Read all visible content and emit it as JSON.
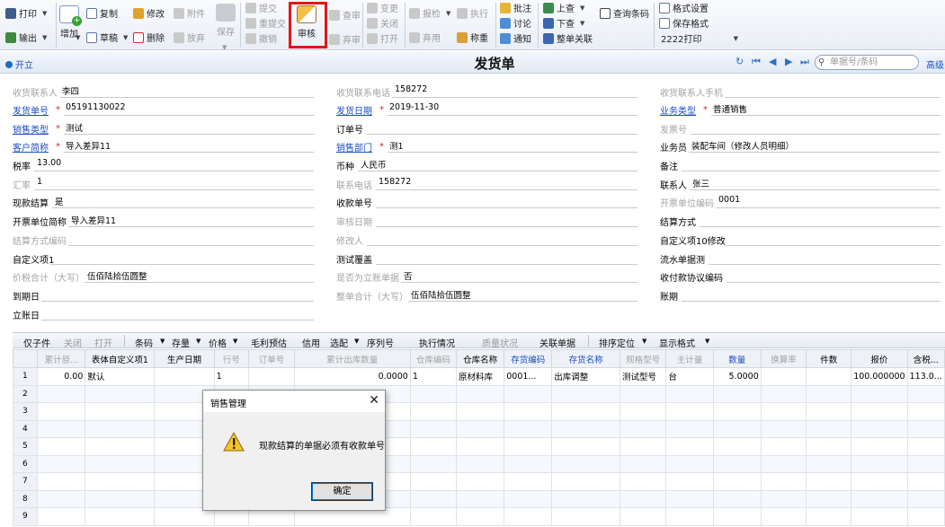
{
  "toolbar": {
    "print": "打印",
    "export": "输出",
    "add": "增加",
    "copy": "复制",
    "draft": "草稿",
    "modify": "修改",
    "delete": "删除",
    "attach": "附件",
    "abandon": "放弃",
    "save": "保存",
    "submit": "提交",
    "resubmit": "重提交",
    "withdraw": "撤销",
    "review": "审核",
    "check": "查审",
    "discard": "弃审",
    "change": "变更",
    "close": "关闭",
    "open": "打开",
    "reportcheck": "报检",
    "reverse": "弃用",
    "execute": "执行",
    "weigh": "称重",
    "annotate": "批注",
    "discuss": "讨论",
    "notify": "通知",
    "prev_query": "上查",
    "next_query": "下查",
    "link": "整单关联",
    "query_barcode": "查询条码",
    "format_settings": "格式设置",
    "save_format": "保存格式",
    "print_template": "2222打印"
  },
  "header": {
    "open": "开立",
    "title": "发货单",
    "search_placeholder": "单据号/条码",
    "advanced": "高级"
  },
  "form": {
    "f_contact": "收货联系人",
    "v_contact": "李四",
    "f_phone": "收货联系电话",
    "v_phone": "158272",
    "f_mobile": "收货联系人手机",
    "f_no": "发货单号",
    "v_no": "05191130022",
    "f_date": "发货日期",
    "v_date": "2019-11-30",
    "f_btype": "业务类型",
    "v_btype": "普通销售",
    "f_stype": "销售类型",
    "v_stype": "测试",
    "f_order": "订单号",
    "f_invno": "发票号",
    "f_customer": "客户简称",
    "v_customer": "导入差异11",
    "f_dept": "销售部门",
    "v_dept": "测1",
    "f_salesman": "业务员",
    "v_salesman": "装配车间（修改人员明细）",
    "f_tax": "税率",
    "v_tax": "13.00",
    "f_currency": "币种",
    "v_currency": "人民币",
    "f_remark": "备注",
    "f_rate": "汇率",
    "v_rate": "1",
    "f_tel": "联系电话",
    "v_tel": "158272",
    "f_person": "联系人",
    "v_person": "张三",
    "f_cash": "现款结算",
    "v_cash": "是",
    "f_receipt": "收款单号",
    "f_invunitcode": "开票单位编码",
    "v_invunitcode": "0001",
    "f_invunit": "开票单位简称",
    "v_invunit": "导入差异11",
    "f_auditdate": "审核日期",
    "f_settle": "结算方式",
    "f_settlecode": "结算方式编码",
    "f_modifier": "修改人",
    "f_def10": "自定义项10修改",
    "f_def1": "自定义项1",
    "f_cover": "测试覆盖",
    "f_flow": "流水单据测",
    "f_total": "价税合计（大写）",
    "v_total": "伍佰陆拾伍圆整",
    "f_isbill": "是否为立账单据",
    "v_isbill": "否",
    "f_protocol": "收付款协议编码",
    "f_due": "到期日",
    "f_wholetotal": "整单合计（大写）",
    "v_wholetotal": "伍佰陆拾伍圆整",
    "f_period": "账期",
    "f_acctdate": "立账日"
  },
  "grid_toolbar": [
    "仅子件",
    "关闭",
    "打开",
    "条码",
    "存量",
    "价格",
    "毛利预估",
    "信用",
    "选配",
    "序列号",
    "执行情况",
    "质量状况",
    "关联单据",
    "排序定位",
    "显示格式"
  ],
  "grid": {
    "columns": [
      "",
      "累计原...",
      "表体自定义项1",
      "生产日期",
      "行号",
      "订单号",
      "累计出库数量",
      "仓库编码",
      "仓库名称",
      "存货编码",
      "存货名称",
      "规格型号",
      "主计量",
      "数量",
      "换算率",
      "件数",
      "报价",
      "含税..."
    ],
    "rows": [
      [
        "1",
        "0.00",
        "默认",
        "",
        "1",
        "",
        "0.0000",
        "1",
        "原材料库",
        "0001...",
        "出库调整",
        "测试型号",
        "台",
        "5.0000",
        "",
        "",
        "100.000000",
        "113.0..."
      ],
      [
        "2",
        "",
        "",
        "",
        "",
        "",
        "",
        "",
        "",
        "",
        "",
        "",
        "",
        "",
        "",
        "",
        "",
        ""
      ],
      [
        "3",
        "",
        "",
        "",
        "",
        "",
        "",
        "",
        "",
        "",
        "",
        "",
        "",
        "",
        "",
        "",
        "",
        ""
      ],
      [
        "4",
        "",
        "",
        "",
        "",
        "",
        "",
        "",
        "",
        "",
        "",
        "",
        "",
        "",
        "",
        "",
        "",
        ""
      ],
      [
        "5",
        "",
        "",
        "",
        "",
        "",
        "",
        "",
        "",
        "",
        "",
        "",
        "",
        "",
        "",
        "",
        "",
        ""
      ],
      [
        "6",
        "",
        "",
        "",
        "",
        "",
        "",
        "",
        "",
        "",
        "",
        "",
        "",
        "",
        "",
        "",
        "",
        ""
      ],
      [
        "7",
        "",
        "",
        "",
        "",
        "",
        "",
        "",
        "",
        "",
        "",
        "",
        "",
        "",
        "",
        "",
        "",
        ""
      ],
      [
        "8",
        "",
        "",
        "",
        "",
        "",
        "",
        "",
        "",
        "",
        "",
        "",
        "",
        "",
        "",
        "",
        "",
        ""
      ],
      [
        "9",
        "",
        "",
        "",
        "",
        "",
        "",
        "",
        "",
        "",
        "",
        "",
        "",
        "",
        "",
        "",
        "",
        ""
      ]
    ]
  },
  "dialog": {
    "title": "销售管理",
    "message": "现款结算的单据必须有收款单号",
    "ok": "确定"
  }
}
